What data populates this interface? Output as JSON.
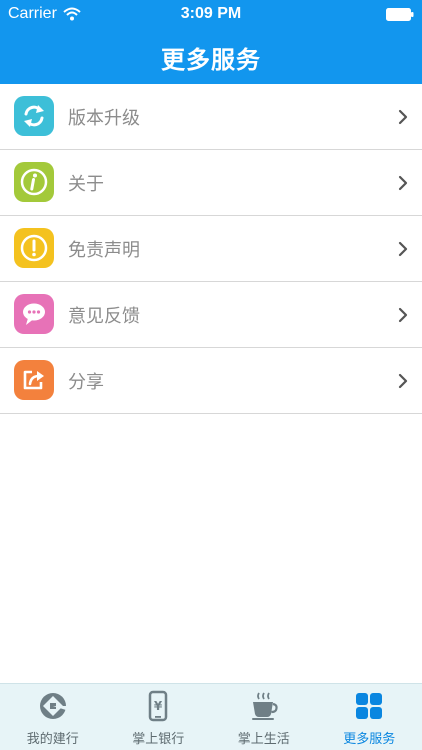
{
  "status_bar": {
    "carrier": "Carrier",
    "time": "3:09 PM",
    "icons": [
      "wifi-icon",
      "battery-icon"
    ]
  },
  "header": {
    "title": "更多服务",
    "color": "#1296ee"
  },
  "menu": {
    "items": [
      {
        "label": "版本升级",
        "icon": "refresh-icon",
        "color": "#3dbfd8"
      },
      {
        "label": "关于",
        "icon": "info-icon",
        "color": "#a3c93a"
      },
      {
        "label": "免责声明",
        "icon": "exclamation-icon",
        "color": "#f4c21f"
      },
      {
        "label": "意见反馈",
        "icon": "chat-bubble-icon",
        "color": "#e772b7"
      },
      {
        "label": "分享",
        "icon": "share-icon",
        "color": "#f3813d"
      }
    ]
  },
  "tabbar": {
    "tabs": [
      {
        "label": "我的建行",
        "icon": "ccb-logo-icon",
        "active": false
      },
      {
        "label": "掌上银行",
        "icon": "mobile-yen-icon",
        "active": false
      },
      {
        "label": "掌上生活",
        "icon": "coffee-cup-icon",
        "active": false
      },
      {
        "label": "更多服务",
        "icon": "grid-icon",
        "active": true
      }
    ],
    "active_color": "#0a86e0"
  }
}
